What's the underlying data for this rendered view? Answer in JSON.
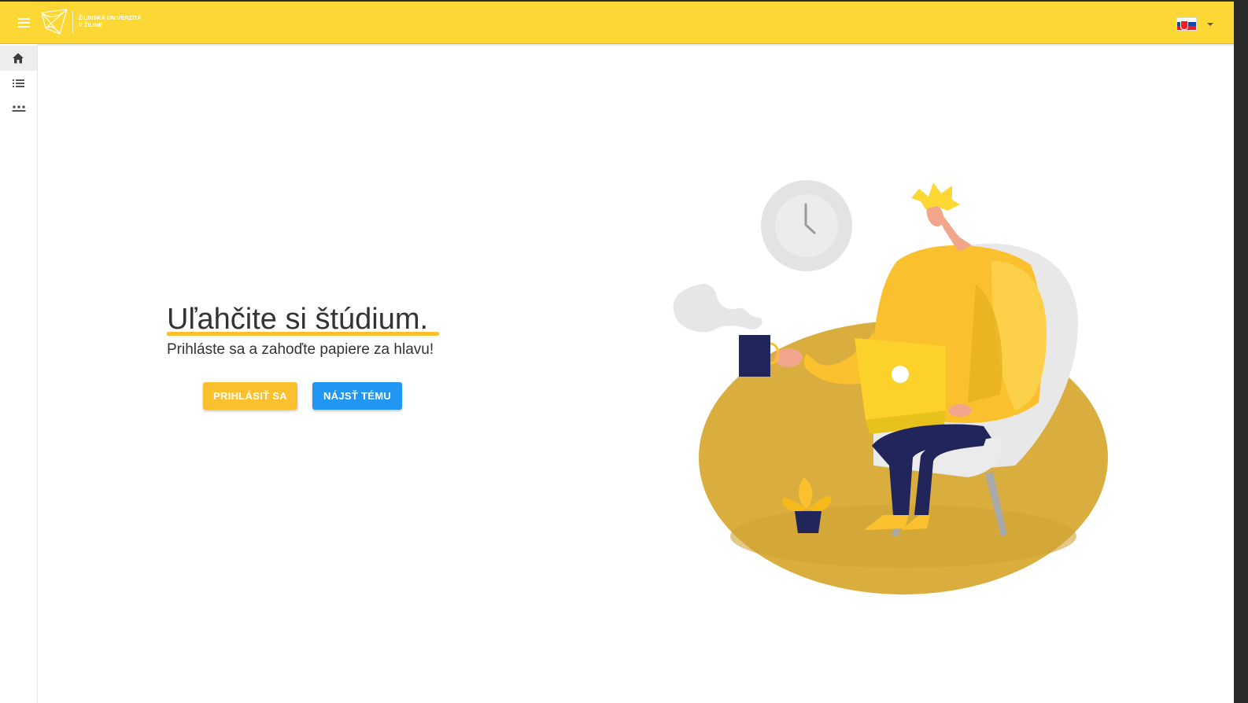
{
  "header": {
    "logo_text_line1": "ŽILINSKÁ UNIVERZITA",
    "logo_text_line2": "V ŽILINE",
    "language": "sk"
  },
  "sidebar": {
    "items": [
      {
        "icon": "home-icon",
        "active": true
      },
      {
        "icon": "list-icon",
        "active": false
      },
      {
        "icon": "more-icon",
        "active": false
      }
    ]
  },
  "hero": {
    "title": "Uľahčite si štúdium.",
    "subtitle": "Prihláste sa a zahoďte papiere za hlavu!",
    "login_button": "PRIHLÁSIŤ SA",
    "find_topic_button": "NÁJSŤ TÉMU"
  },
  "colors": {
    "appbar": "#fdd835",
    "accent_yellow": "#fbc02d",
    "accent_blue": "#2196f3",
    "text": "#333333"
  }
}
